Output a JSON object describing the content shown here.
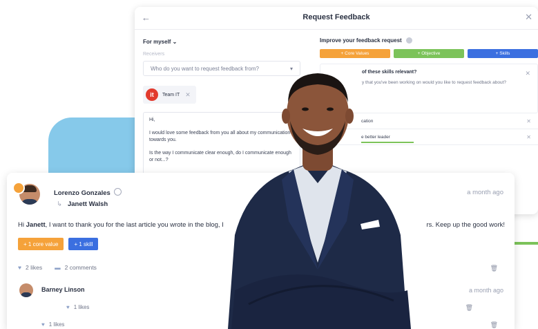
{
  "modal": {
    "title": "Request Feedback",
    "back_glyph": "←",
    "close_glyph": "✕",
    "for_myself": "For myself ⌄",
    "receivers_label": "Receivers",
    "receiver_placeholder": "Who do you want to request feedback from?",
    "dropdown_glyph": "▾",
    "team_chip": "Team IT",
    "team_logo_text": "it",
    "chip_close": "✕",
    "message_lines": [
      "Hi,",
      "I would love some feedback from you all about my communication towards you.",
      "Is the way I communicate clear enough, do I communicate enough or not...?"
    ],
    "improve_title": "Improve your feedback request",
    "buttons": [
      {
        "label": "+ Core Values",
        "color": "#f5a23a"
      },
      {
        "label": "+ Objective",
        "color": "#7cc35a"
      },
      {
        "label": "+ Skills",
        "color": "#3b6fe0"
      }
    ],
    "skills_question": "of these skills relevant?",
    "skills_description": "y that you've been working on would you like to request feedback about?",
    "skill_rows": [
      "cation",
      "e better leader"
    ]
  },
  "post": {
    "author": "Lorenzo Gonzales",
    "recipient": "Janett Walsh",
    "reply_glyph": "↳",
    "time": "a month ago",
    "text_start": "Hi ",
    "text_name": "Janett",
    "text_mid": ", I want to thank you for the last article you wrote in the blog, I",
    "text_tail": "rs. Keep up the good work!",
    "tag_core": "+ 1 core value",
    "tag_skill": "+ 1 skill",
    "likes": "2 likes",
    "comments": "2 comments",
    "reply": {
      "author": "Barney Linson",
      "time": "a month ago",
      "likes": "1 likes",
      "likes_second": "1 likes"
    }
  },
  "colors": {
    "accent_orange": "#f5a23a",
    "accent_green": "#7cc35a",
    "accent_blue": "#3b6fe0",
    "backdrop_blue": "#86c9ea"
  }
}
